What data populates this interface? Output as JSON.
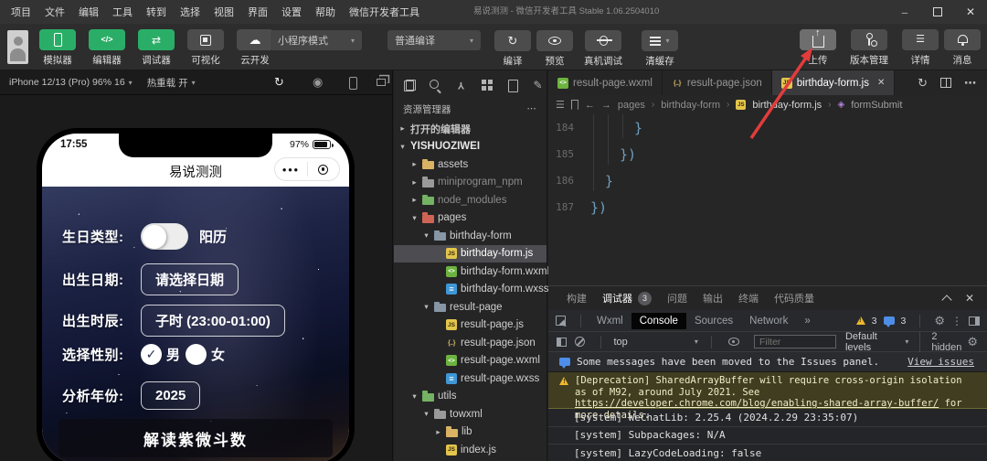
{
  "titlebar": {
    "menus": [
      "项目",
      "文件",
      "编辑",
      "工具",
      "转到",
      "选择",
      "视图",
      "界面",
      "设置",
      "帮助",
      "微信开发者工具"
    ],
    "title": "易说测测 - 微信开发者工具 Stable 1.06.2504010"
  },
  "toolbar": {
    "sim_buttons": [
      {
        "label": "模拟器"
      },
      {
        "label": "编辑器"
      },
      {
        "label": "调试器"
      },
      {
        "label": "可视化"
      },
      {
        "label": "云开发"
      }
    ],
    "mode_select": "小程序模式",
    "compile_select": "普通编译",
    "actions": [
      {
        "label": "编译"
      },
      {
        "label": "预览"
      },
      {
        "label": "真机调试"
      },
      {
        "label": "清缓存"
      }
    ],
    "right_actions": [
      {
        "label": "上传"
      },
      {
        "label": "版本管理"
      },
      {
        "label": "详情"
      },
      {
        "label": "消息"
      }
    ],
    "accent_green": "#2aae67"
  },
  "simulator": {
    "device": "iPhone 12/13 (Pro) 96% 16",
    "hot_reload": "热重载 开",
    "phone": {
      "time": "17:55",
      "battery": "97%",
      "app_title": "易说测测",
      "form": {
        "birthday_type_label": "生日类型:",
        "birthday_type_value": "阳历",
        "birth_date_label": "出生日期:",
        "birth_date_value": "请选择日期",
        "birth_hour_label": "出生时辰:",
        "birth_hour_value": "子时 (23:00-01:00)",
        "gender_label": "选择性别:",
        "gender_male": "男",
        "gender_female": "女",
        "year_label": "分析年份:",
        "year_value": "2025",
        "submit_label": "解读紫微斗数"
      }
    }
  },
  "explorer": {
    "header": "资源管理器",
    "more": "⋯",
    "tree": [
      {
        "t": "▸",
        "label": "打开的编辑器"
      },
      {
        "t": "▾",
        "label": "YISHUOZIWEI"
      },
      {
        "t": "▸",
        "label": "assets"
      },
      {
        "t": "▸",
        "label": "miniprogram_npm"
      },
      {
        "t": "▸",
        "label": "node_modules"
      },
      {
        "t": "▾",
        "label": "pages"
      },
      {
        "t": "▾",
        "label": "birthday-form"
      },
      {
        "t": "",
        "label": "birthday-form.js"
      },
      {
        "t": "",
        "label": "birthday-form.wxml"
      },
      {
        "t": "",
        "label": "birthday-form.wxss"
      },
      {
        "t": "▾",
        "label": "result-page"
      },
      {
        "t": "",
        "label": "result-page.js"
      },
      {
        "t": "",
        "label": "result-page.json"
      },
      {
        "t": "",
        "label": "result-page.wxml"
      },
      {
        "t": "",
        "label": "result-page.wxss"
      },
      {
        "t": "▾",
        "label": "utils"
      },
      {
        "t": "▾",
        "label": "towxml"
      },
      {
        "t": "▸",
        "label": "lib"
      },
      {
        "t": "",
        "label": "index.js"
      }
    ]
  },
  "editor": {
    "tabs": [
      {
        "label": "result-page.wxml"
      },
      {
        "label": "result-page.json"
      },
      {
        "label": "birthday-form.js"
      }
    ],
    "breadcrumb": {
      "p1": "pages",
      "p2": "birthday-form",
      "p3": "birthday-form.js",
      "p4": "formSubmit"
    },
    "lines": [
      {
        "num": "184",
        "code": "}"
      },
      {
        "num": "185",
        "code": "})"
      },
      {
        "num": "186",
        "code": "}"
      },
      {
        "num": "187",
        "code": "})"
      }
    ]
  },
  "panel": {
    "tabs": {
      "build": "构建",
      "dbg": "调试器",
      "badge": "3",
      "problems": "问题",
      "output": "输出",
      "terminal": "终端",
      "quality": "代码质量"
    },
    "devtools": {
      "wxml": "Wxml",
      "console": "Console",
      "sources": "Sources",
      "network": "Network",
      "more": "»",
      "warn_count": "3",
      "issue_count": "3"
    },
    "toolbar": {
      "context": "top",
      "filter_placeholder": "Filter",
      "levels": "Default levels",
      "hidden": "2 hidden"
    },
    "console": {
      "info_text": "Some messages have been moved to the Issues panel.",
      "info_link": "View issues",
      "warn_pre": "[Deprecation] SharedArrayBuffer will require cross-origin isolation as of M92, around July 2021. See ",
      "warn_link": "https://developer.chrome.com/blog/enabling-shared-array-buffer/",
      "warn_post": " for more details.",
      "logs": [
        "[system] WeChatLib: 2.25.4 (2024.2.29 23:35:07)",
        "[system] Subpackages: N/A",
        "[system] LazyCodeLoading: false"
      ]
    }
  },
  "annotation": {
    "arrow_color": "#e23c3c"
  }
}
